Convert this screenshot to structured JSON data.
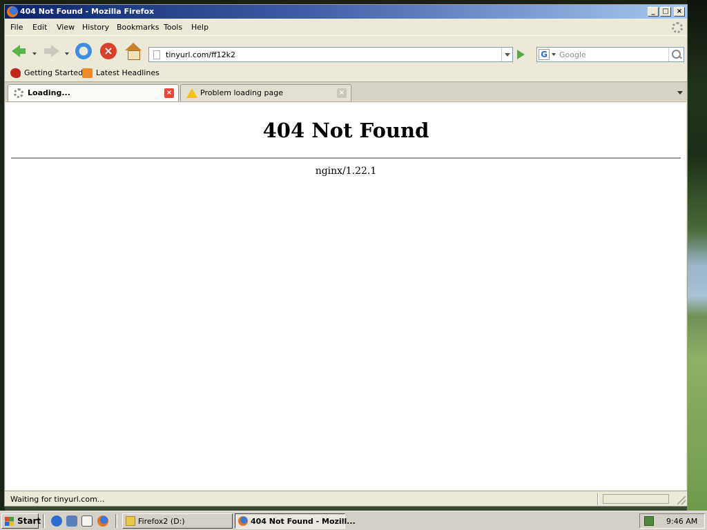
{
  "window": {
    "title": "404 Not Found - Mozilla Firefox",
    "minimize_glyph": "_",
    "maximize_glyph": "□",
    "close_glyph": "×"
  },
  "menu": [
    "File",
    "Edit",
    "View",
    "History",
    "Bookmarks",
    "Tools",
    "Help"
  ],
  "toolbar": {
    "url": "tinyurl.com/ff12k2",
    "search_placeholder": "Google",
    "search_engine_glyph": "G",
    "stop_glyph": "×"
  },
  "bookmarks": [
    "Getting Started",
    "Latest Headlines"
  ],
  "tabs": [
    {
      "label": "Loading...",
      "close_glyph": "×"
    },
    {
      "label": "Problem loading page",
      "close_glyph": "×"
    }
  ],
  "page": {
    "heading": "404 Not Found",
    "server": "nginx/1.22.1"
  },
  "status": {
    "text": "Waiting for tinyurl.com..."
  },
  "taskbar": {
    "start": "Start",
    "tasks": [
      "Firefox2 (D:)",
      "404 Not Found - Mozill..."
    ],
    "clock": "9:46 AM"
  },
  "colors": {
    "titlebar_start": "#0a246a",
    "titlebar_end": "#a6caf0",
    "chrome": "#ece9d8",
    "taskbar": "#d4d0c8"
  },
  "icons": {
    "back": "back-arrow-icon",
    "forward": "forward-arrow-icon",
    "reload": "reload-icon",
    "stop": "stop-icon",
    "home": "home-icon",
    "go": "go-arrow-icon",
    "search": "magnifier-icon",
    "loading": "spinner-icon",
    "warning": "warning-icon"
  }
}
